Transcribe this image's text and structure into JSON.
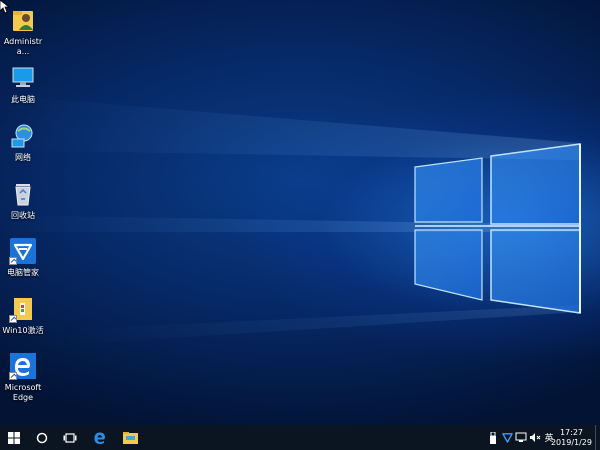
{
  "desktop": {
    "icons": [
      {
        "label": "Administra...",
        "icon": "user-folder-icon"
      },
      {
        "label": "此电脑",
        "icon": "computer-icon"
      },
      {
        "label": "网络",
        "icon": "network-icon"
      },
      {
        "label": "回收站",
        "icon": "recycle-bin-icon"
      },
      {
        "label": "电脑管家",
        "icon": "pc-manager-shield-icon"
      },
      {
        "label": "Win10激活",
        "icon": "activation-folder-icon"
      },
      {
        "label": "Microsoft Edge",
        "icon": "edge-icon"
      }
    ]
  },
  "taskbar": {
    "apps": [
      "windows-start-icon",
      "cortana-search-icon",
      "task-view-icon",
      "edge-icon",
      "file-explorer-icon"
    ],
    "tray": {
      "language": "英",
      "time": "17:27",
      "date": "2019/1/29"
    }
  },
  "colors": {
    "wallpaper_dark": "#021334",
    "wallpaper_glow": "#288cff",
    "taskbar": "#0b1522",
    "edge_blue": "#1a73d9"
  }
}
